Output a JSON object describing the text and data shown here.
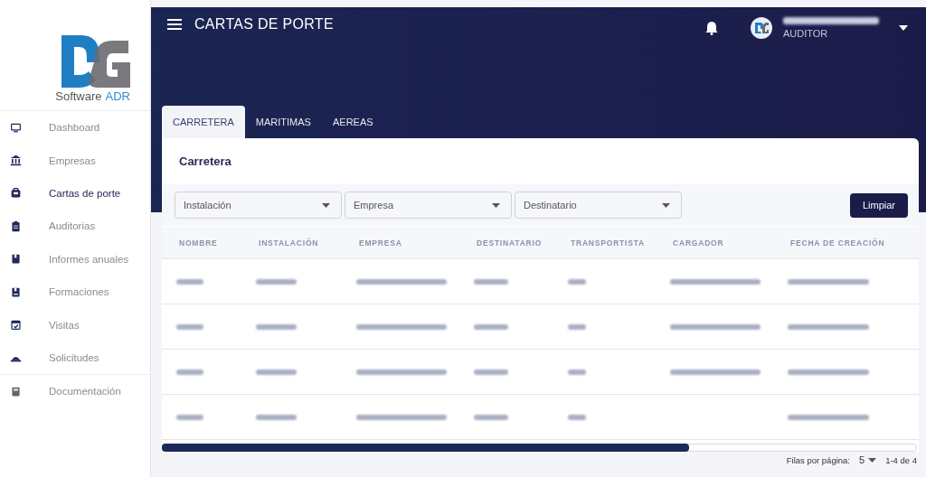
{
  "logo": {
    "text": "Software",
    "accent": "ADR"
  },
  "nav": {
    "sections": [
      [
        {
          "label": "Dashboard",
          "selected": false
        },
        {
          "label": "Empresas",
          "selected": false
        },
        {
          "label": "Cartas de porte",
          "selected": true
        },
        {
          "label": "Auditorias",
          "selected": false
        },
        {
          "label": "Informes anuales",
          "selected": false
        },
        {
          "label": "Formaciones",
          "selected": false
        },
        {
          "label": "Visitas",
          "selected": false
        },
        {
          "label": "Solicitudes",
          "selected": false
        }
      ],
      [
        {
          "label": "Documentación",
          "selected": false
        }
      ]
    ]
  },
  "header": {
    "title": "CARTAS DE PORTE",
    "user": {
      "role": "AUDITOR",
      "name_redacted": true
    }
  },
  "tabs": [
    {
      "label": "CARRETERA",
      "selected": true
    },
    {
      "label": "MARITIMAS",
      "selected": false
    },
    {
      "label": "AEREAS",
      "selected": false
    }
  ],
  "card": {
    "title": "Carretera",
    "filters": [
      {
        "placeholder": "Instalación"
      },
      {
        "placeholder": "Empresa"
      },
      {
        "placeholder": "Destinatario"
      }
    ],
    "clear_button": "Limpiar"
  },
  "table": {
    "columns": [
      "NOMBRE",
      "INSTALACIÓN",
      "EMPRESA",
      "DESTINATARIO",
      "TRANSPORTISTA",
      "CARGADOR",
      "FECHA DE CREACIÓN"
    ],
    "rows": [
      {
        "cells": [
          {
            "kind": "redacted"
          },
          {
            "kind": "redacted"
          },
          {
            "kind": "redacted"
          },
          {
            "kind": "redacted"
          },
          {
            "kind": "redacted"
          },
          {
            "kind": "redacted"
          },
          {
            "kind": "redacted"
          }
        ]
      },
      {
        "cells": [
          {
            "kind": "redacted"
          },
          {
            "kind": "redacted"
          },
          {
            "kind": "redacted"
          },
          {
            "kind": "redacted"
          },
          {
            "kind": "redacted"
          },
          {
            "kind": "redacted"
          },
          {
            "kind": "redacted"
          }
        ]
      },
      {
        "cells": [
          {
            "kind": "redacted"
          },
          {
            "kind": "redacted"
          },
          {
            "kind": "redacted"
          },
          {
            "kind": "redacted"
          },
          {
            "kind": "redacted"
          },
          {
            "kind": "redacted"
          },
          {
            "kind": "redacted"
          }
        ]
      },
      {
        "cells": [
          {
            "kind": "redacted"
          },
          {
            "kind": "redacted"
          },
          {
            "kind": "redacted"
          },
          {
            "kind": "redacted"
          },
          {
            "kind": "redacted"
          },
          {
            "kind": "empty"
          },
          {
            "kind": "redacted"
          }
        ]
      }
    ]
  },
  "pagination": {
    "rows_label": "Filas por página:",
    "rows_value": "5",
    "range": "1-4 de 4"
  }
}
